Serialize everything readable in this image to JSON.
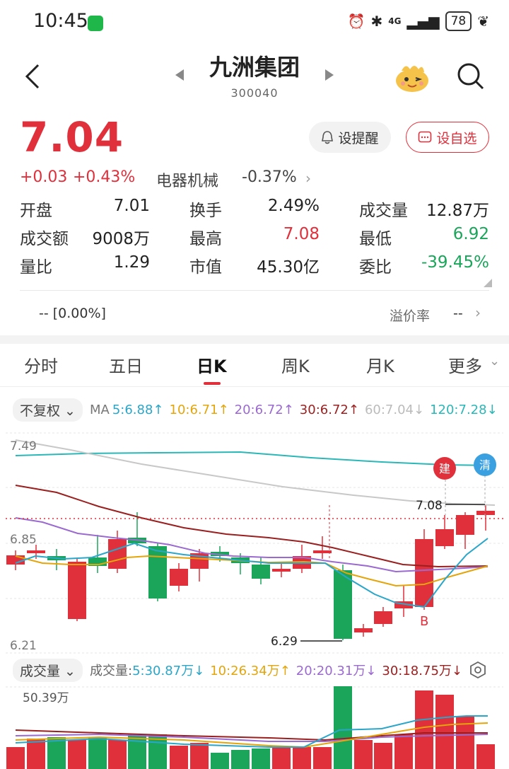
{
  "status_bar": {
    "time": "10:45",
    "network": "4G",
    "battery": "78"
  },
  "header": {
    "name": "九洲集团",
    "code": "300040",
    "alert_label": "设提醒",
    "fav_label": "设自选"
  },
  "quote": {
    "price": "7.04",
    "change": "+0.03",
    "change_pct": "+0.43%",
    "sector": "电器机械",
    "sector_change": "-0.37%"
  },
  "stats": [
    {
      "label": "开盘",
      "value": "7.01",
      "color": "normal"
    },
    {
      "label": "换手",
      "value": "2.49%",
      "color": "normal"
    },
    {
      "label": "成交量",
      "value": "12.87万",
      "color": "normal"
    },
    {
      "label": "成交额",
      "value": "9008万",
      "color": "normal"
    },
    {
      "label": "最高",
      "value": "7.08",
      "color": "red"
    },
    {
      "label": "最低",
      "value": "6.92",
      "color": "green"
    },
    {
      "label": "量比",
      "value": "1.29",
      "color": "normal"
    },
    {
      "label": "市值",
      "value": "45.30亿",
      "color": "normal"
    },
    {
      "label": "委比",
      "value": "-39.45%",
      "color": "green"
    }
  ],
  "premium": {
    "left": "-- [0.00%]",
    "label": "溢价率",
    "value": "--"
  },
  "tabs": [
    "分时",
    "五日",
    "日K",
    "周K",
    "月K",
    "更多"
  ],
  "active_tab": "日K",
  "ma_bar": {
    "adjust": "不复权",
    "prefix": "MA",
    "items": [
      "5:6.88↑",
      "10:6.71↑",
      "20:6.72↑",
      "30:6.72↑",
      "60:7.04↓",
      "120:7.28↓"
    ]
  },
  "kline": {
    "y_top": "7.49",
    "y_mid": "6.85",
    "y_bot": "6.21",
    "high_label": "7.08",
    "low_label": "6.29",
    "marker_build": "建",
    "marker_clear": "清",
    "marker_b": "B"
  },
  "volume": {
    "selector": "成交量",
    "prefix": "成交量:",
    "items": [
      "5:30.87万↓",
      "10:26.34万↑",
      "20:20.31万↓",
      "30:18.75万↓"
    ],
    "max_label": "50.39万"
  },
  "colors": {
    "up": "#e0303c",
    "down": "#1aa55a"
  }
}
